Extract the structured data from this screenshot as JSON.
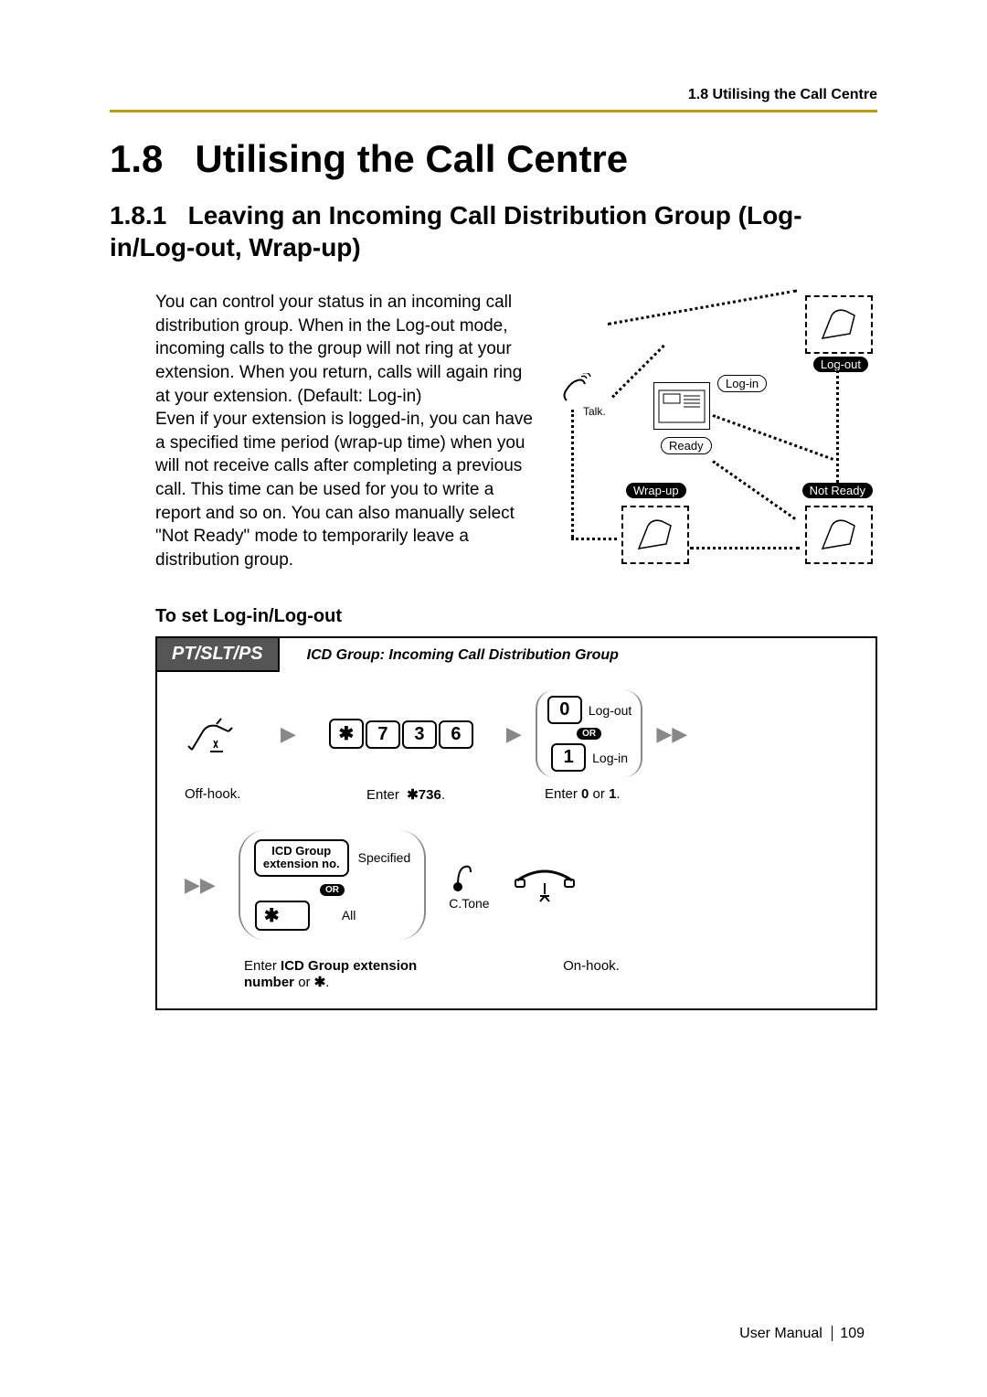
{
  "running_head": "1.8 Utilising the Call Centre",
  "section_number": "1.8",
  "section_title": "Utilising the Call Centre",
  "subsection_number": "1.8.1",
  "subsection_title": "Leaving an Incoming Call Distribution Group (Log-in/Log-out, Wrap-up)",
  "body_paragraph_1": "You can control your status in an incoming call distribution group. When in the Log-out mode, incoming calls to the group will not ring at your extension. When you return, calls will again ring at your extension. (Default: Log-in)",
  "body_paragraph_2": "Even if your extension is logged-in, you can have a specified time period (wrap-up time) when you will not receive calls after completing a previous call. This time can be used for you to write a report and so on. You can also manually select \"Not Ready\" mode to temporarily leave a distribution group.",
  "diagram": {
    "talk_label": "Talk.",
    "login_label": "Log-in",
    "logout_label": "Log-out",
    "ready_label": "Ready",
    "wrapup_label": "Wrap-up",
    "notready_label": "Not Ready"
  },
  "procedure_heading": "To set Log-in/Log-out",
  "pt_tab": "PT/SLT/PS",
  "icd_note": "ICD Group: Incoming Call Distribution Group",
  "steps": {
    "offhook": "Off-hook.",
    "enter_code": "Enter",
    "code_star": "✱",
    "code_digits": "736",
    "code_keys": [
      "7",
      "3",
      "6"
    ],
    "opt_0_key": "0",
    "opt_0_label": "Log-out",
    "or_label": "OR",
    "opt_1_key": "1",
    "opt_1_label": "Log-in",
    "enter_0_or_1_a": "Enter",
    "enter_0_or_1_b": "0",
    "enter_0_or_1_c": "or",
    "enter_0_or_1_d": "1",
    "enter_0_or_1_e": ".",
    "icd_key_line1": "ICD Group",
    "icd_key_line2": "extension no.",
    "specified_label": "Specified",
    "all_label": "All",
    "ctone": "C.Tone",
    "enter_ext_a": "Enter",
    "enter_ext_b": "ICD Group extension number",
    "enter_ext_c": "or",
    "enter_ext_d": "✱",
    "enter_ext_e": ".",
    "onhook": "On-hook."
  },
  "footer": {
    "manual": "User Manual",
    "page": "109"
  }
}
